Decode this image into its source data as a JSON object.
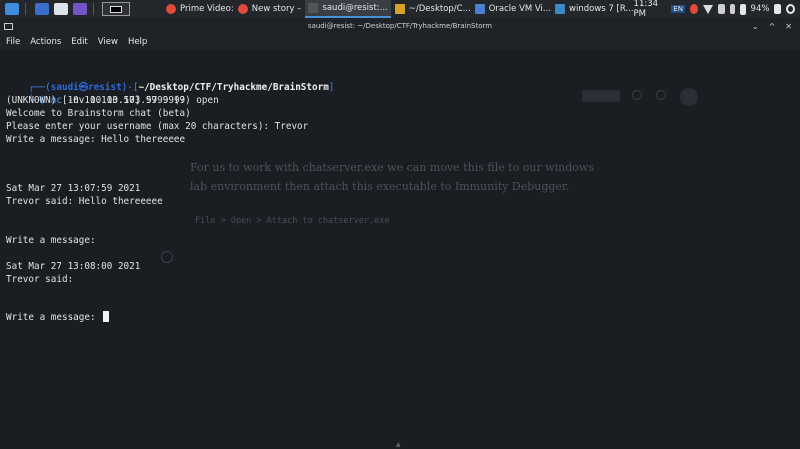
{
  "taskbar": {
    "tasks": [
      {
        "label": "Prime Video:",
        "color": "#e44"
      },
      {
        "label": "New story –",
        "color": "#e44"
      },
      {
        "label": "saudi@resist:...",
        "color": "#555"
      },
      {
        "label": "~/Desktop/C...",
        "color": "#d8a12a"
      },
      {
        "label": "Oracle VM Vi...",
        "color": "#4a7fd1"
      },
      {
        "label": "windows 7 [R...",
        "color": "#3b8ac4"
      }
    ],
    "time": "11:34 PM",
    "lang": "EN",
    "battery": "94%"
  },
  "window": {
    "title": "saudi@resist: ~/Desktop/CTF/Tryhackme/BrainStorm",
    "minimize": "⌄",
    "maximize": "^",
    "close": "✕"
  },
  "menu": [
    "File",
    "Actions",
    "Edit",
    "View",
    "Help"
  ],
  "background_window": {
    "paragraph": "For us to work with chatserver.exe we can move this file to our windows lab environment then attach this executable to Immunity Debugger.",
    "code": "File > Open > Attach to chatserver.exe"
  },
  "terminal": {
    "prompt_user": "saudi",
    "prompt_host": "resist",
    "prompt_path": "~/Desktop/CTF/Tryhackme/BrainStorm",
    "command_name": "nc",
    "command_args": "-nv 10.10.103.57 9999",
    "output": [
      "(UNKNOWN) [10.10.103.57] 9999 (?) open",
      "Welcome to Brainstorm chat (beta)",
      "Please enter your username (max 20 characters): Trevor",
      "Write a message: Hello thereeeee",
      "",
      "",
      "Sat Mar 27 13:07:59 2021",
      "Trevor said: Hello thereeeee",
      "",
      "",
      "Write a message:",
      "",
      "Sat Mar 27 13:08:00 2021",
      "Trevor said:",
      "",
      "",
      "Write a message: "
    ]
  }
}
